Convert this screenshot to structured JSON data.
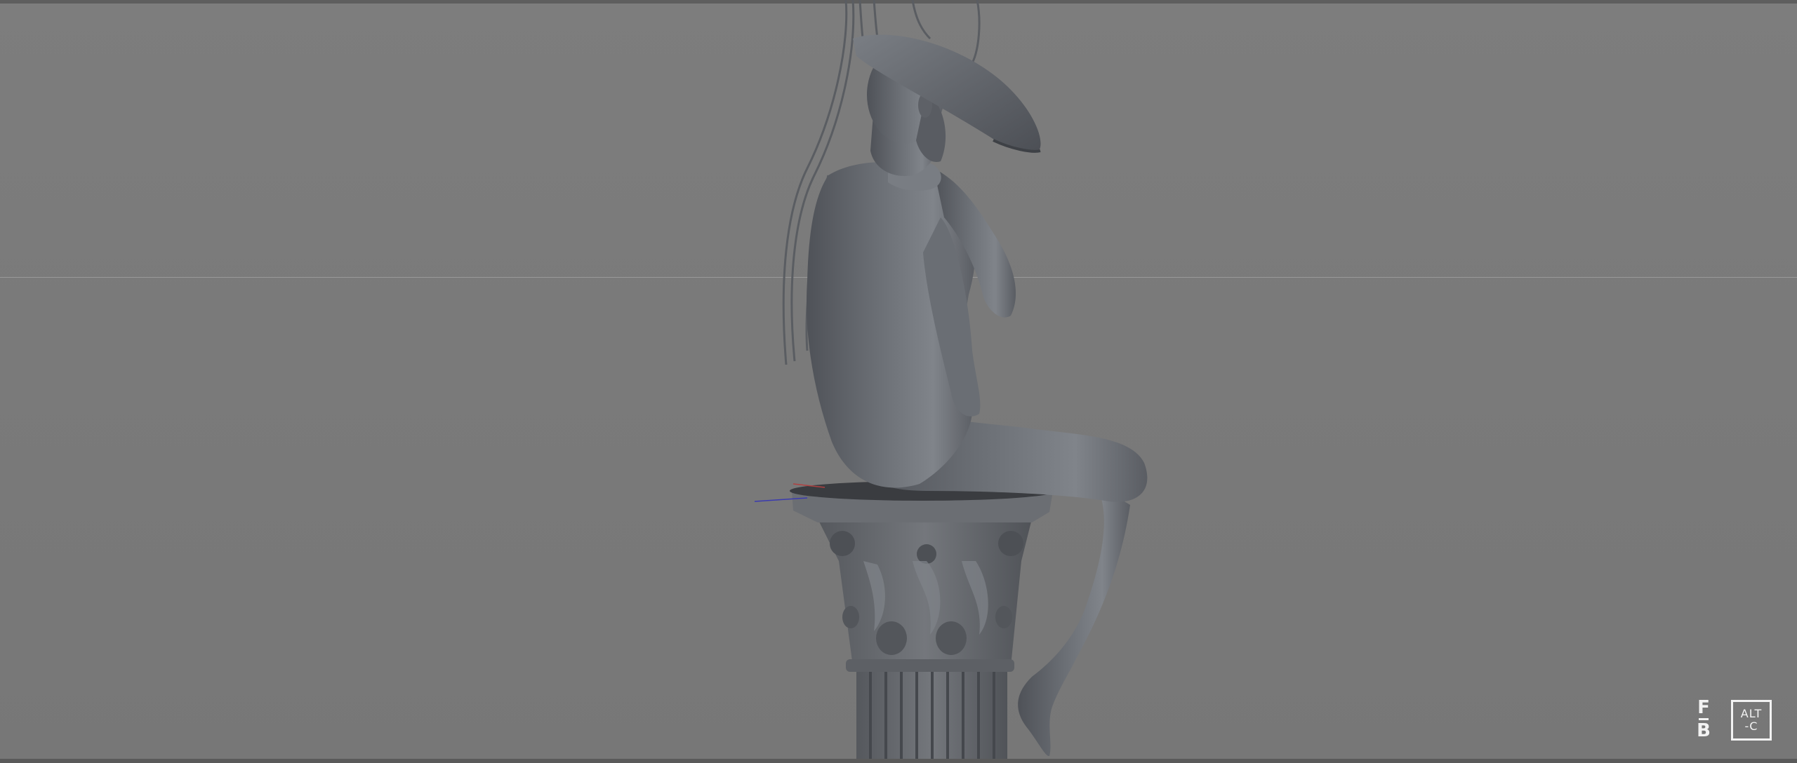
{
  "viewport": {
    "background": "#7b7b7b",
    "model_color": "#666a70"
  },
  "watermarks": {
    "left_top": "F",
    "left_bottom": "B",
    "right_line1": "ALT",
    "right_line2": "-C"
  }
}
